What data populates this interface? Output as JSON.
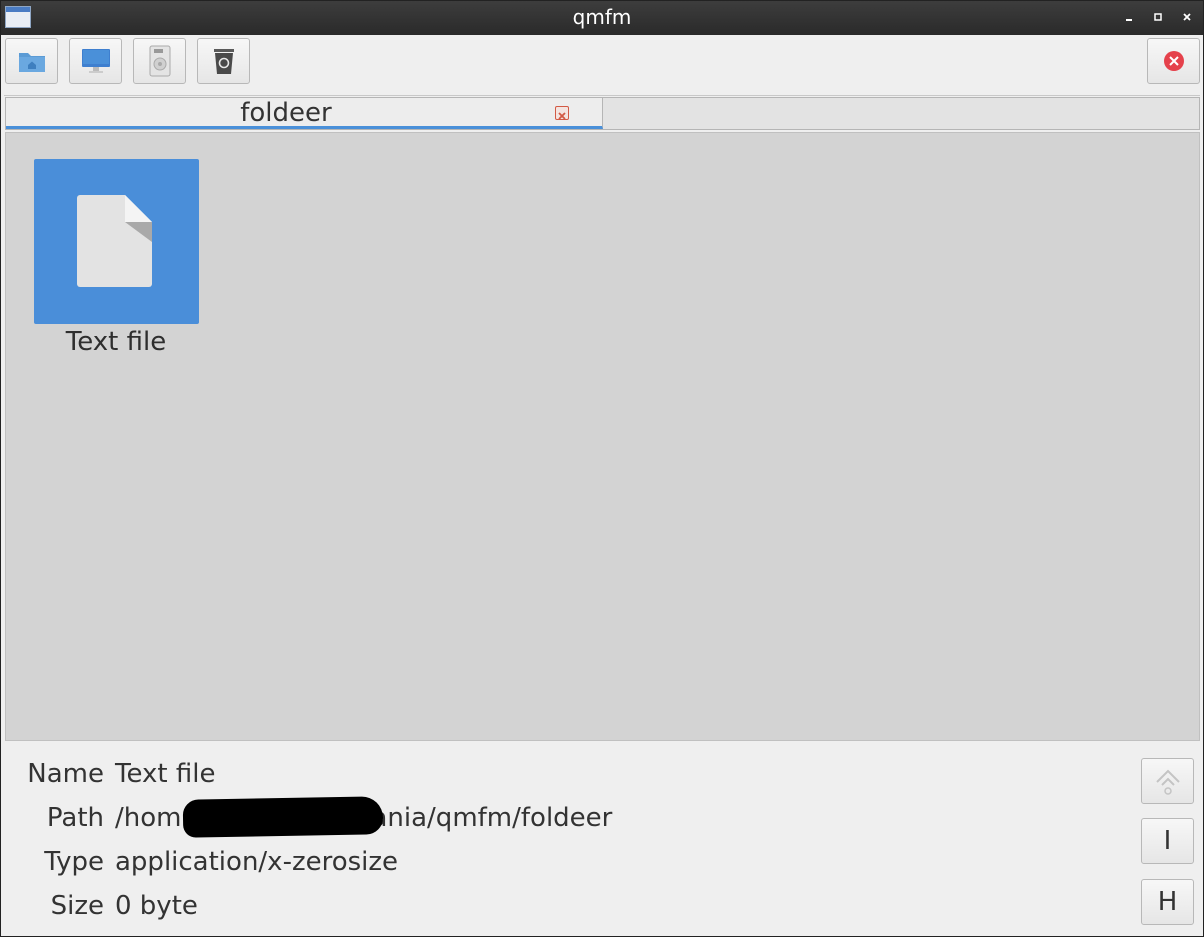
{
  "window": {
    "title": "qmfm"
  },
  "toolbar": {
    "buttons": [
      {
        "icon": "home-folder-icon"
      },
      {
        "icon": "computer-icon"
      },
      {
        "icon": "drive-icon"
      },
      {
        "icon": "trash-icon"
      }
    ],
    "close_icon": "close-icon"
  },
  "tabs": [
    {
      "label": "foldeer"
    }
  ],
  "files": [
    {
      "name": "Text file",
      "icon": "text-file-icon"
    }
  ],
  "info": {
    "name_label": "Name",
    "name_value": "Text file",
    "path_label": "Path",
    "path_value_start": "/hom",
    "path_value_end": "ania/qmfm/foldeer",
    "type_label": "Type",
    "type_value": "application/x-zerosize",
    "size_label": "Size",
    "size_value": "0 byte"
  },
  "side_buttons": {
    "up_icon": "up-arrow-icon",
    "info_label": "I",
    "hidden_label": "H"
  },
  "colors": {
    "accent": "#4a90d9",
    "close_red": "#e5414b",
    "selection": "#4a8ed9"
  }
}
